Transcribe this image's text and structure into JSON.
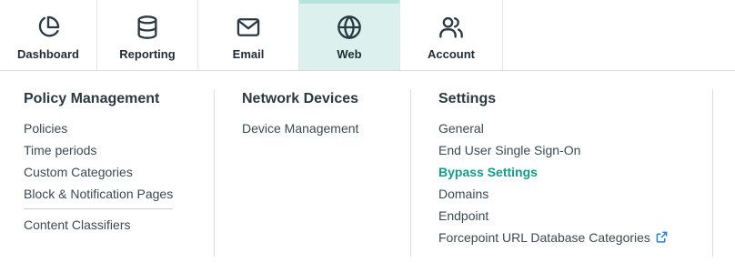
{
  "nav": {
    "tabs": [
      {
        "label": "Dashboard",
        "icon": "pie-chart-icon",
        "active": false
      },
      {
        "label": "Reporting",
        "icon": "database-icon",
        "active": false
      },
      {
        "label": "Email",
        "icon": "mail-icon",
        "active": false
      },
      {
        "label": "Web",
        "icon": "globe-icon",
        "active": true
      },
      {
        "label": "Account",
        "icon": "users-icon",
        "active": false
      }
    ]
  },
  "menu": {
    "policy": {
      "title": "Policy Management",
      "items": [
        "Policies",
        "Time periods",
        "Custom Categories",
        "Block & Notification Pages"
      ],
      "extra": "Content Classifiers"
    },
    "network": {
      "title": "Network Devices",
      "items": [
        "Device Management"
      ]
    },
    "settings": {
      "title": "Settings",
      "items": [
        "General",
        "End User Single Sign-On",
        "Bypass Settings",
        "Domains",
        "Endpoint",
        "Forcepoint URL Database Categories"
      ],
      "active_item": "Bypass Settings",
      "external_icon": "external-link-icon"
    }
  },
  "colors": {
    "accent": "#149b8a",
    "active_tab_bg": "#dcf1ee",
    "link": "#2a7dd1"
  }
}
